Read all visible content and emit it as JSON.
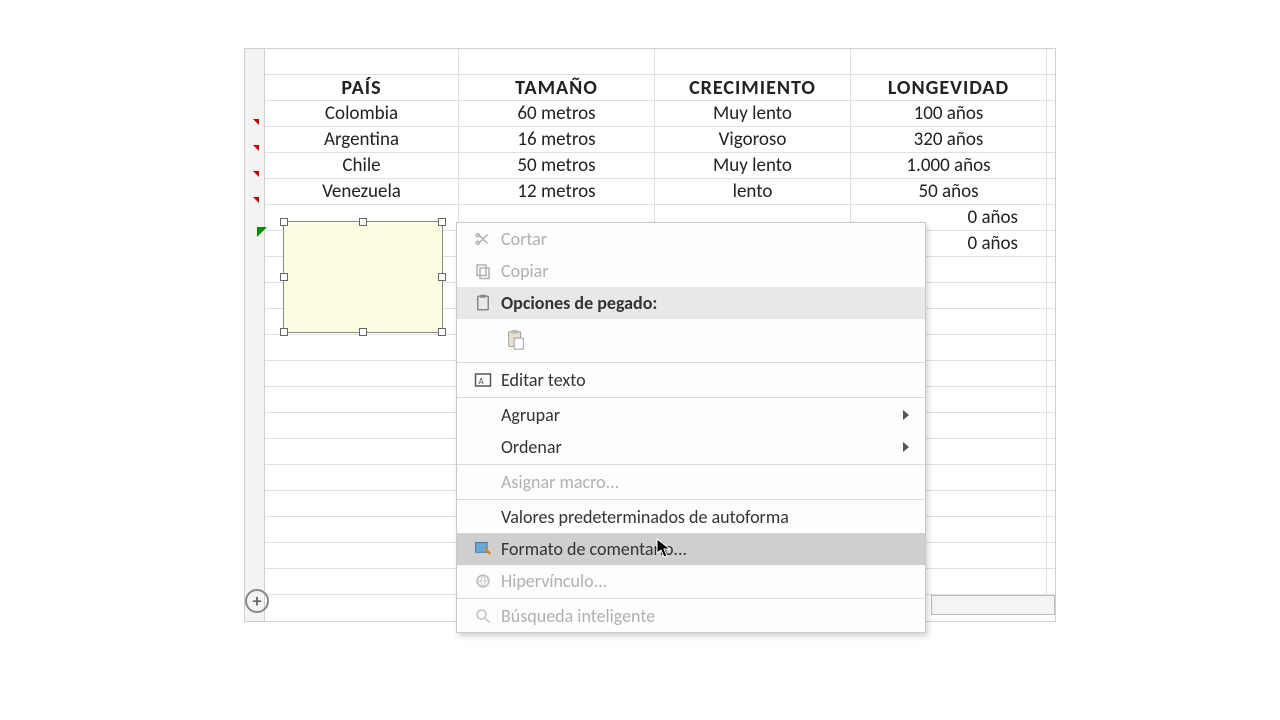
{
  "table": {
    "headers": [
      "PAÍS",
      "TAMAÑO",
      "CRECIMIENTO",
      "LONGEVIDAD"
    ],
    "rows": [
      [
        "Colombia",
        "60 metros",
        "Muy lento",
        "100 años"
      ],
      [
        "Argentina",
        "16 metros",
        "Vigoroso",
        "320 años"
      ],
      [
        "Chile",
        "50 metros",
        "Muy lento",
        "1.000 años"
      ],
      [
        "Venezuela",
        "12 metros",
        "lento",
        "50 años"
      ]
    ],
    "partial_rows_longevidad": [
      "0 años",
      "0 años"
    ]
  },
  "context_menu": {
    "cut": "Cortar",
    "copy": "Copiar",
    "paste_options": "Opciones de pegado:",
    "edit_text": "Editar texto",
    "group": "Agrupar",
    "sort": "Ordenar",
    "assign_macro": "Asignar macro...",
    "autoshape_defaults": "Valores predeterminados de autoforma",
    "format_comment": "Formato de comentario...",
    "hyperlink": "Hipervínculo...",
    "smart_lookup": "Búsqueda inteligente"
  },
  "add_sheet_label": "+"
}
